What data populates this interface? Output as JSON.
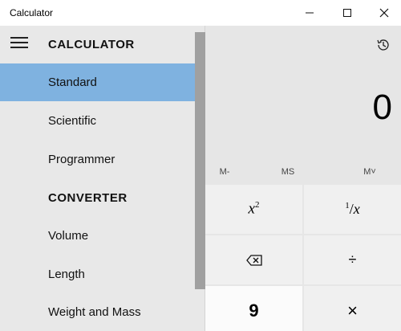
{
  "window": {
    "title": "Calculator",
    "minimize_icon": "minimize-icon",
    "maximize_icon": "maximize-icon",
    "close_icon": "close-icon"
  },
  "nav": {
    "menu_icon": "hamburger-icon",
    "calculator_header": "CALCULATOR",
    "converter_header": "CONVERTER",
    "calculator_items": [
      {
        "label": "Standard",
        "selected": true
      },
      {
        "label": "Scientific",
        "selected": false
      },
      {
        "label": "Programmer",
        "selected": false
      }
    ],
    "converter_items": [
      {
        "label": "Volume"
      },
      {
        "label": "Length"
      },
      {
        "label": "Weight and Mass"
      }
    ]
  },
  "calculator": {
    "history_icon": "history-icon",
    "display_value": "0",
    "memory_buttons": [
      "M-",
      "MS",
      "M˅"
    ],
    "keys": {
      "square": "x²",
      "reciprocal": "¹/x",
      "backspace_icon": "backspace-icon",
      "divide": "÷",
      "nine": "9",
      "multiply": "×"
    }
  },
  "colors": {
    "selected_item": "#7fb2e0",
    "nav_background": "#e8e8e8",
    "title_bar": "#ffffff"
  }
}
